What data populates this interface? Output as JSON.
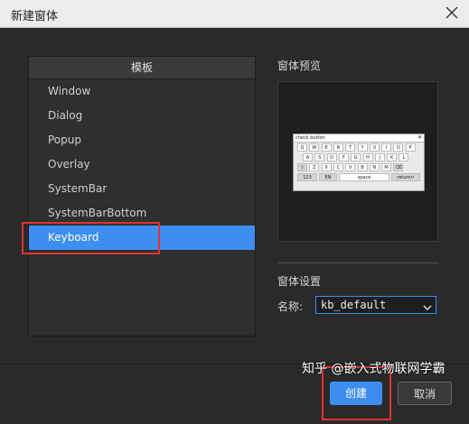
{
  "window": {
    "title": "新建窗体"
  },
  "templates": {
    "header": "模板",
    "items": [
      "Window",
      "Dialog",
      "Popup",
      "Overlay",
      "SystemBar",
      "SystemBarBottom",
      "Keyboard"
    ],
    "selected": "Keyboard"
  },
  "preview": {
    "label": "窗体预览",
    "keyboard": {
      "title": "check button",
      "row1": [
        "Q",
        "W",
        "E",
        "R",
        "T",
        "Y",
        "U",
        "I",
        "O",
        "P"
      ],
      "row2": [
        "A",
        "S",
        "D",
        "F",
        "G",
        "H",
        "J",
        "K",
        "L"
      ],
      "row3": [
        "⇧",
        "Z",
        "X",
        "C",
        "V",
        "B",
        "N",
        "M",
        "⌫"
      ],
      "row4": [
        "123",
        "EN",
        "space",
        "return↵"
      ]
    }
  },
  "settings": {
    "label": "窗体设置",
    "name_label": "名称:",
    "name_value": "kb_default"
  },
  "buttons": {
    "create": "创建",
    "cancel": "取消"
  },
  "watermark": "知乎 @嵌入式物联网学霸",
  "colors": {
    "accent": "#3d8ef0",
    "highlight": "#e03333"
  }
}
